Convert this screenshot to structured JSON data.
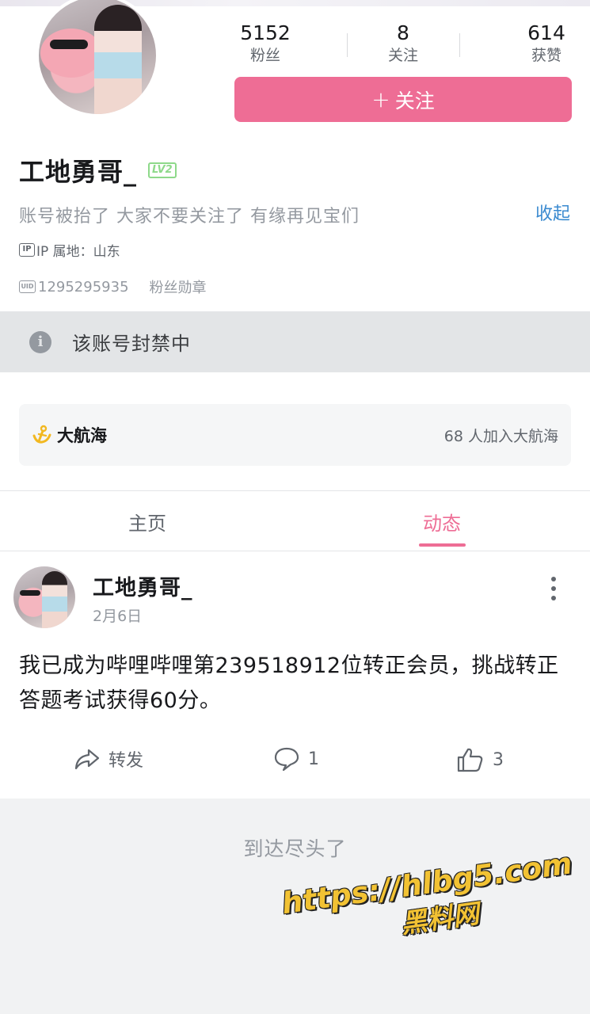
{
  "stats": [
    {
      "value": "5152",
      "label": "粉丝"
    },
    {
      "value": "8",
      "label": "关注"
    },
    {
      "value": "614",
      "label": "获赞"
    }
  ],
  "follow_button": {
    "icon": "plus-icon",
    "label": "关注"
  },
  "profile": {
    "name": "工地勇哥_",
    "level": "LV2",
    "level_color": "#8ed98a",
    "bio": "账号被抬了 大家不要关注了 有缘再见宝们",
    "collapse_label": "收起",
    "ip_icon": "IP",
    "ip_location": "IP 属地：山东",
    "uid_icon": "UID",
    "uid": "1295295935",
    "medal_label": "粉丝勋章"
  },
  "banned_notice": {
    "icon": "info-icon",
    "text": "该账号封禁中"
  },
  "guard": {
    "icon": "anchor-icon",
    "title": "大航海",
    "count_text": "68 人加入大航海"
  },
  "tabs": [
    {
      "label": "主页",
      "active": false
    },
    {
      "label": "动态",
      "active": true
    }
  ],
  "post": {
    "author": "工地勇哥_",
    "date": "2月6日",
    "text": "我已成为哔哩哔哩第239518912位转正会员，挑战转正答题考试获得60分。",
    "actions": {
      "share_label": "转发",
      "comment_count": "1",
      "like_count": "3"
    }
  },
  "end_text": "到达尽头了",
  "watermark": {
    "url": "https://hlbg5.com",
    "name": "黑料网"
  },
  "colors": {
    "accent_pink": "#ee6d95",
    "link_blue": "#3a8ad0",
    "banned_bg": "#e3e5e7",
    "page_bg": "#f1f2f3"
  }
}
